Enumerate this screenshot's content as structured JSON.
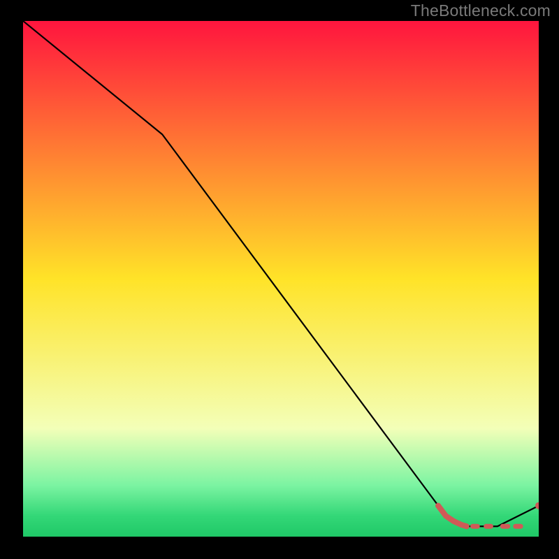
{
  "watermark": "TheBottleneck.com",
  "colors": {
    "line": "#000000",
    "marker": "#cf5a57",
    "gradient_top": "#ff153e",
    "gradient_yellow": "#ffe328",
    "gradient_light": "#f3ffb8",
    "gradient_green1": "#7cf4a2",
    "gradient_green2": "#33d777",
    "gradient_bottom": "#1fc867"
  },
  "chart_data": {
    "type": "line",
    "title": "",
    "xlabel": "",
    "ylabel": "",
    "xlim": [
      0,
      100
    ],
    "ylim": [
      0,
      100
    ],
    "series": [
      {
        "name": "curve",
        "style": "line",
        "x": [
          0,
          27,
          82,
          86,
          92,
          100
        ],
        "y": [
          100,
          78,
          4,
          2,
          2,
          6
        ]
      },
      {
        "name": "markers-segment",
        "style": "markers-thick",
        "x": [
          80.5,
          82,
          83.5,
          85,
          86
        ],
        "y": [
          6.0,
          4.0,
          3.0,
          2.3,
          2.0
        ]
      },
      {
        "name": "markers-dashed",
        "style": "markers-dash",
        "x": [
          87.2,
          88.1,
          89.8,
          90.7,
          93.0,
          94.0,
          95.5,
          96.5,
          98.0
        ],
        "y": [
          2,
          2,
          2,
          2,
          2,
          2,
          2,
          2,
          2
        ]
      },
      {
        "name": "marker-end",
        "style": "dot",
        "x": [
          100
        ],
        "y": [
          6
        ]
      }
    ],
    "background_gradient": {
      "stops": [
        {
          "offset": 0.0,
          "color": "#ff153e"
        },
        {
          "offset": 0.5,
          "color": "#ffe328"
        },
        {
          "offset": 0.79,
          "color": "#f3ffb8"
        },
        {
          "offset": 0.9,
          "color": "#7cf4a2"
        },
        {
          "offset": 0.96,
          "color": "#33d777"
        },
        {
          "offset": 1.0,
          "color": "#1fc867"
        }
      ]
    }
  }
}
